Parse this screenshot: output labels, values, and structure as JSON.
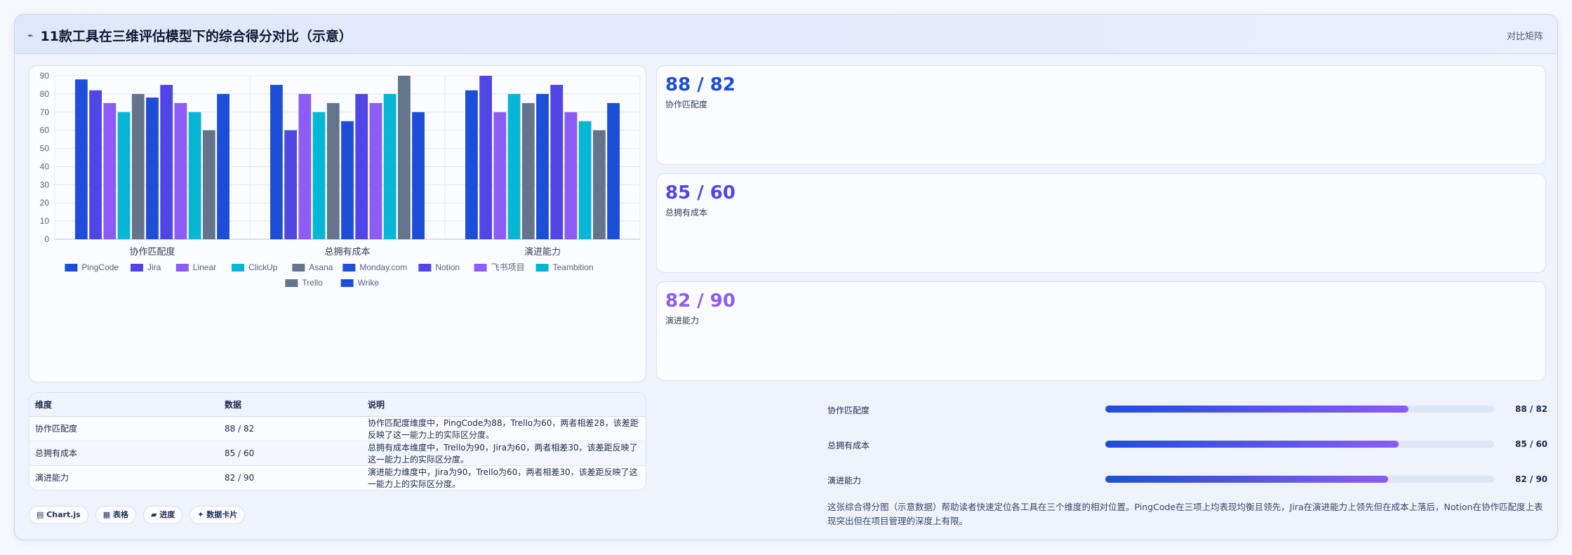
{
  "header": {
    "title": "11款工具在三维评估模型下的综合得分对比（示意）",
    "title_icon": "chart-trend-icon",
    "right_label": "对比矩阵"
  },
  "chart_data": {
    "type": "bar",
    "categories": [
      "协作匹配度",
      "总拥有成本",
      "演进能力"
    ],
    "ylim": [
      0,
      90
    ],
    "yticks": [
      0,
      10,
      20,
      30,
      40,
      50,
      60,
      70,
      80,
      90
    ],
    "legend_position": "bottom",
    "grid": true,
    "series": [
      {
        "name": "PingCode",
        "color": "#1d4ed8",
        "values": [
          88,
          85,
          82
        ]
      },
      {
        "name": "Jira",
        "color": "#4f46e5",
        "values": [
          82,
          60,
          90
        ]
      },
      {
        "name": "Linear",
        "color": "#8b5cf6",
        "values": [
          75,
          80,
          70
        ]
      },
      {
        "name": "ClickUp",
        "color": "#06b6d4",
        "values": [
          70,
          70,
          80
        ]
      },
      {
        "name": "Asana",
        "color": "#64748b",
        "values": [
          80,
          75,
          75
        ]
      },
      {
        "name": "Monday.com",
        "color": "#1d4ed8",
        "values": [
          78,
          65,
          80
        ]
      },
      {
        "name": "Notion",
        "color": "#4f46e5",
        "values": [
          85,
          80,
          85
        ]
      },
      {
        "name": "飞书项目",
        "color": "#8b5cf6",
        "values": [
          75,
          75,
          70
        ]
      },
      {
        "name": "Teambition",
        "color": "#06b6d4",
        "values": [
          70,
          80,
          65
        ]
      },
      {
        "name": "Trello",
        "color": "#64748b",
        "values": [
          60,
          90,
          60
        ]
      },
      {
        "name": "Wrike",
        "color": "#1d4ed8",
        "values": [
          80,
          70,
          75
        ]
      }
    ]
  },
  "kpis": [
    {
      "value": "88 / 82",
      "label": "协作匹配度",
      "color": "#1d4ed8"
    },
    {
      "value": "85 / 60",
      "label": "总拥有成本",
      "color": "#4f46e5"
    },
    {
      "value": "82 / 90",
      "label": "演进能力",
      "color": "#8b5cf6"
    }
  ],
  "table": {
    "headers": [
      "维度",
      "数据",
      "说明"
    ],
    "rows": [
      [
        "协作匹配度",
        "88 / 82",
        "协作匹配度维度中，PingCode为88，Trello为60，两者相差28，该差距反映了这一能力上的实际区分度。"
      ],
      [
        "总拥有成本",
        "85 / 60",
        "总拥有成本维度中，Trello为90，Jira为60，两者相差30，该差距反映了这一能力上的实际区分度。"
      ],
      [
        "演进能力",
        "82 / 90",
        "演进能力维度中，Jira为90，Trello为60，两者相差30，该差距反映了这一能力上的实际区分度。"
      ]
    ]
  },
  "chips": [
    {
      "label": "▤ Chart.js",
      "icon": "chart-icon"
    },
    {
      "label": "▦ 表格",
      "icon": "table-icon"
    },
    {
      "label": "▰ 进度",
      "icon": "progress-icon"
    },
    {
      "label": "✦ 数据卡片",
      "icon": "card-icon"
    }
  ],
  "progress": [
    {
      "label": "协作匹配度",
      "value": "88 / 82",
      "fraction": 0.78
    },
    {
      "label": "总拥有成本",
      "value": "85 / 60",
      "fraction": 0.755
    },
    {
      "label": "演进能力",
      "value": "82 / 90",
      "fraction": 0.728
    }
  ],
  "description": "这张综合得分图（示意数据）帮助读者快速定位各工具在三个维度的相对位置。PingCode在三项上均表现均衡且领先，Jira在演进能力上领先但在成本上落后，Notion在协作匹配度上表现突出但在项目管理的深度上有限。"
}
